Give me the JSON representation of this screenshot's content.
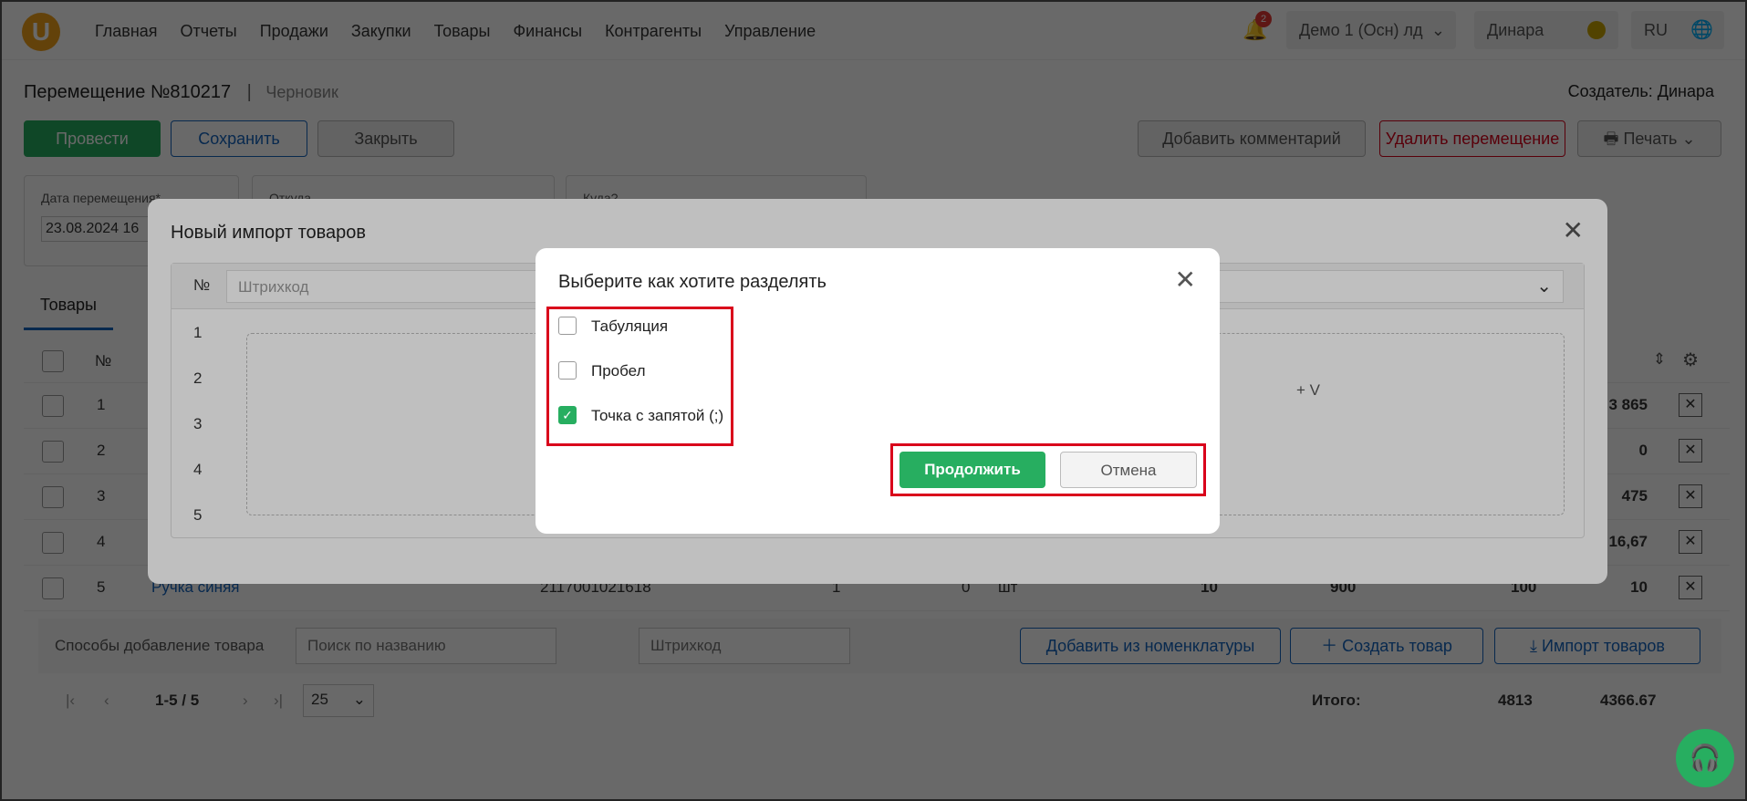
{
  "nav": {
    "logo": "U",
    "menu": [
      "Главная",
      "Отчеты",
      "Продажи",
      "Закупки",
      "Товары",
      "Финансы",
      "Контрагенты",
      "Управление"
    ],
    "notifications": "2",
    "org": "Демо 1 (Осн) лд",
    "user": "Динара",
    "lang": "RU"
  },
  "doc": {
    "title": "Перемещение №810217",
    "status": "Черновик",
    "creator": "Создатель: Динара",
    "buttons": {
      "conduct": "Провести",
      "save": "Сохранить",
      "close": "Закрыть",
      "comment": "Добавить комментарий",
      "delete": "Удалить перемещение",
      "print": "Печать"
    },
    "fields": {
      "date_label": "Дата перемещения*",
      "date_value": "23.08.2024 16",
      "from_label": "Откуда",
      "to_label": "Куда?"
    },
    "tab": "Товары"
  },
  "table": {
    "header_num": "№",
    "rows": [
      {
        "n": "1",
        "name": "",
        "barcode": "",
        "q1": "",
        "q2": "",
        "unit": "",
        "a": "",
        "b": "",
        "c": "",
        "d": "3 865"
      },
      {
        "n": "2",
        "name": "",
        "barcode": "",
        "q1": "",
        "q2": "",
        "unit": "",
        "a": "",
        "b": "",
        "c": "",
        "d": "0"
      },
      {
        "n": "3",
        "name": "",
        "barcode": "",
        "q1": "",
        "q2": "",
        "unit": "",
        "a": "",
        "b": "",
        "c": "",
        "d": "475"
      },
      {
        "n": "4",
        "name": "",
        "barcode": "",
        "q1": "",
        "q2": "",
        "unit": "",
        "a": "",
        "b": "",
        "c": "",
        "d": "16,67"
      },
      {
        "n": "5",
        "name": "Ручка синяя",
        "barcode": "2117001021618",
        "q1": "1",
        "q2": "0",
        "unit": "шт",
        "a": "10",
        "b": "900",
        "c": "100",
        "d": "10"
      }
    ]
  },
  "add": {
    "label": "Способы добавление товара",
    "search_placeholder": "Поиск по названию",
    "barcode_placeholder": "Штрихкод",
    "from_nomenclature": "Добавить из номенклатуры",
    "create": "Создать товар",
    "import": "Импорт товаров"
  },
  "pager": {
    "range": "1-5 / 5",
    "per_page": "25",
    "total_label": "Итого:",
    "total_qty": "4813",
    "total_sum": "4366.67"
  },
  "import_modal": {
    "title": "Новый импорт товаров",
    "col_num": "№",
    "col_barcode": "Штрихкод",
    "lines": [
      "1",
      "2",
      "3",
      "4",
      "5"
    ],
    "hint": "+ V"
  },
  "split_modal": {
    "title": "Выберите как хотите разделять",
    "options": [
      {
        "label": "Табуляция",
        "checked": false
      },
      {
        "label": "Пробел",
        "checked": false
      },
      {
        "label": "Точка с запятой (;)",
        "checked": true
      }
    ],
    "continue": "Продолжить",
    "cancel": "Отмена"
  },
  "colors": {
    "green": "#27ae60",
    "blue": "#1565c0",
    "red": "#d9001b",
    "accent": "#f0a21b"
  }
}
